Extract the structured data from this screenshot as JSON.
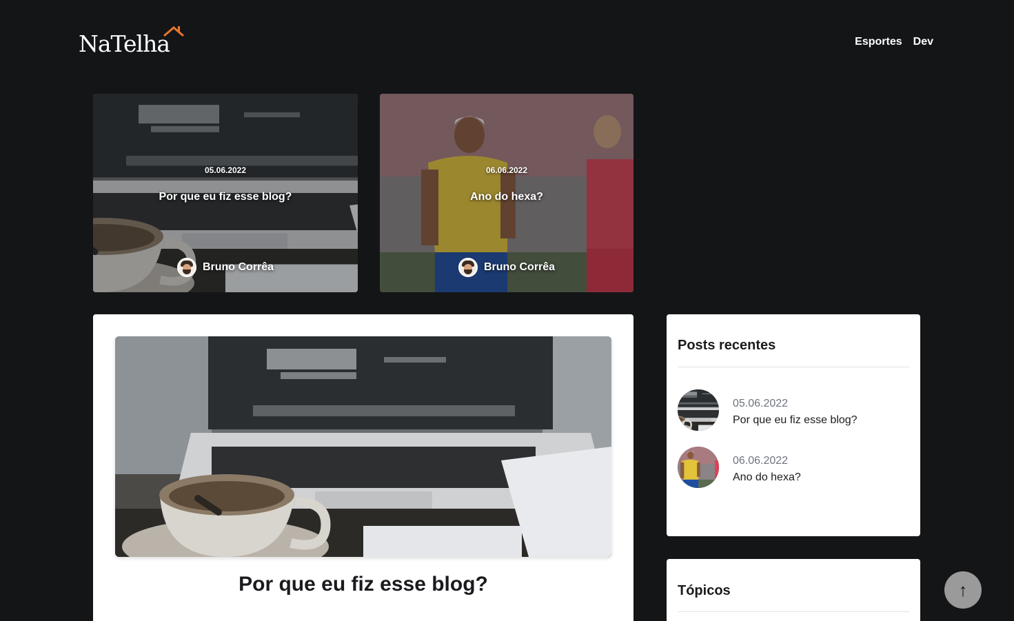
{
  "header": {
    "logo_text": "NaTelha",
    "logo_accent_color": "#e8772e",
    "nav": [
      {
        "label": "Esportes"
      },
      {
        "label": "Dev"
      }
    ]
  },
  "featured": [
    {
      "date": "05.06.2022",
      "title": "Por que eu fiz esse blog?",
      "author": "Bruno Corrêa",
      "image": "coffee-laptop-photo"
    },
    {
      "date": "06.06.2022",
      "title": "Ano do hexa?",
      "author": "Bruno Corrêa",
      "image": "soccer-players-photo"
    }
  ],
  "article": {
    "title": "Por que eu fiz esse blog?",
    "image": "coffee-laptop-photo"
  },
  "sidebar": {
    "recent": {
      "heading": "Posts recentes",
      "items": [
        {
          "date": "05.06.2022",
          "title": "Por que eu fiz esse blog?",
          "image": "coffee-laptop-photo"
        },
        {
          "date": "06.06.2022",
          "title": "Ano do hexa?",
          "image": "soccer-players-photo"
        }
      ]
    },
    "topics": {
      "heading": "Tópicos"
    }
  },
  "back_to_top": {
    "icon": "arrow-up-icon"
  }
}
